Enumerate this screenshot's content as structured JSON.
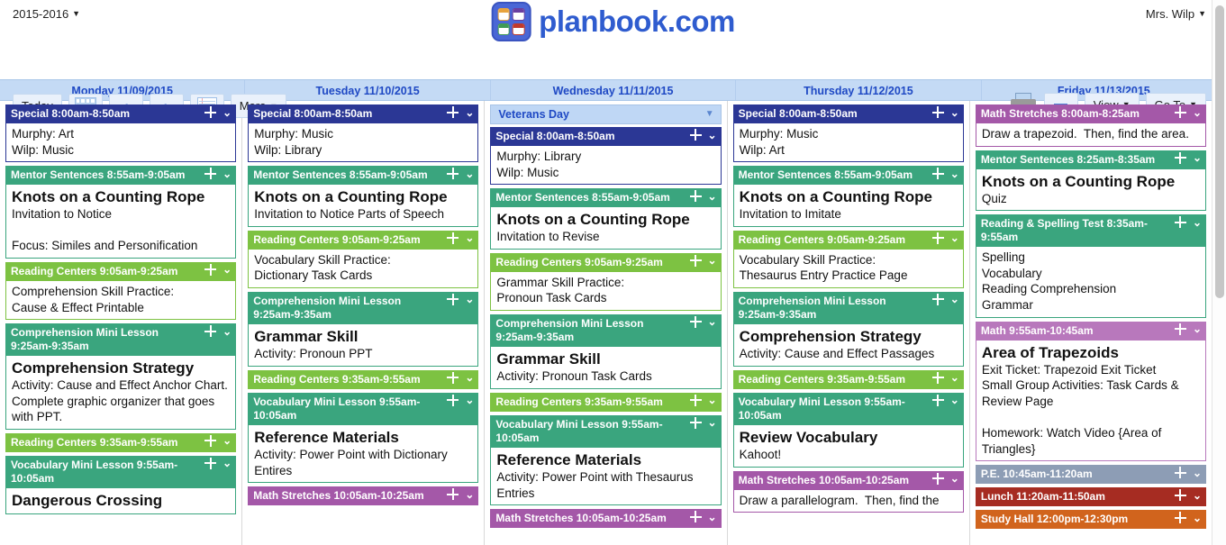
{
  "header": {
    "year_label": "2015-2016",
    "brand": "planbook.com",
    "user": "Mrs. Wilp"
  },
  "toolbar": {
    "today_label": "Today",
    "calendar_icon": "calendar-icon",
    "prev_icon": "‹",
    "next_icon": "›",
    "lines_icon": "lined-paper-icon",
    "more_label": "More",
    "print_icon": "printer-icon",
    "collapse_label": "—",
    "view_label": "View",
    "goto_label": "Go To"
  },
  "colors": {
    "special": "#2b3795",
    "mentor": "#3aa57e",
    "reading_centers": "#7dc242",
    "comprehension": "#3aa57e",
    "vocabulary": "#3aa57e",
    "math": "#a458a8",
    "test": "#3aa57e",
    "pe": "#8d9db5",
    "lunch": "#a62c22",
    "study_hall": "#d1641d",
    "banner": "#bfd7f5",
    "dayheader_text": "#1f49c4"
  },
  "days": [
    {
      "label": "Monday 11/09/2015",
      "banner": null,
      "cards": [
        {
          "title": "Special 8:00am-8:50am",
          "color": "#2b3795",
          "body_lines": [
            {
              "text": "Murphy: Art",
              "style": "sub"
            },
            {
              "text": "Wilp: Music",
              "style": "sub"
            }
          ]
        },
        {
          "title": "Mentor Sentences 8:55am-9:05am",
          "color": "#3aa57e",
          "body_lines": [
            {
              "text": "Knots on a Counting Rope",
              "style": "big"
            },
            {
              "text": "Invitation to Notice",
              "style": "sub"
            },
            {
              "text": "",
              "style": "sub"
            },
            {
              "text": "Focus: Similes and Personification",
              "style": "sub"
            }
          ]
        },
        {
          "title": "Reading Centers 9:05am-9:25am",
          "color": "#7dc242",
          "body_lines": [
            {
              "text": "Comprehension Skill Practice:",
              "style": "sub"
            },
            {
              "text": "Cause & Effect Printable",
              "style": "sub"
            }
          ]
        },
        {
          "title": "Comprehension Mini Lesson 9:25am-9:35am",
          "color": "#3aa57e",
          "body_lines": [
            {
              "text": "Comprehension Strategy",
              "style": "big"
            },
            {
              "text": "Activity: Cause and Effect Anchor Chart. Complete graphic organizer that goes with PPT.",
              "style": "sub"
            }
          ]
        },
        {
          "title": "Reading Centers 9:35am-9:55am",
          "color": "#7dc242",
          "body_lines": []
        },
        {
          "title": "Vocabulary Mini Lesson 9:55am-10:05am",
          "color": "#3aa57e",
          "body_lines": [
            {
              "text": "Dangerous Crossing",
              "style": "big"
            }
          ]
        }
      ]
    },
    {
      "label": "Tuesday 11/10/2015",
      "banner": null,
      "cards": [
        {
          "title": "Special 8:00am-8:50am",
          "color": "#2b3795",
          "body_lines": [
            {
              "text": "Murphy: Music",
              "style": "sub"
            },
            {
              "text": "Wilp: Library",
              "style": "sub"
            }
          ]
        },
        {
          "title": "Mentor Sentences 8:55am-9:05am",
          "color": "#3aa57e",
          "body_lines": [
            {
              "text": "Knots on a Counting Rope",
              "style": "big"
            },
            {
              "text": "Invitation to Notice Parts of Speech",
              "style": "sub"
            }
          ]
        },
        {
          "title": "Reading Centers 9:05am-9:25am",
          "color": "#7dc242",
          "body_lines": [
            {
              "text": "Vocabulary Skill Practice:",
              "style": "sub"
            },
            {
              "text": "Dictionary Task Cards",
              "style": "sub"
            }
          ]
        },
        {
          "title": "Comprehension Mini Lesson 9:25am-9:35am",
          "color": "#3aa57e",
          "body_lines": [
            {
              "text": "Grammar Skill",
              "style": "big"
            },
            {
              "text": "Activity: Pronoun PPT",
              "style": "sub"
            }
          ]
        },
        {
          "title": "Reading Centers 9:35am-9:55am",
          "color": "#7dc242",
          "body_lines": []
        },
        {
          "title": "Vocabulary Mini Lesson 9:55am-10:05am",
          "color": "#3aa57e",
          "body_lines": [
            {
              "text": "Reference Materials",
              "style": "big"
            },
            {
              "text": "Activity: Power Point with Dictionary Entires",
              "style": "sub"
            }
          ]
        },
        {
          "title": "Math Stretches 10:05am-10:25am",
          "color": "#a458a8",
          "body_lines": []
        }
      ]
    },
    {
      "label": "Wednesday 11/11/2015",
      "banner": "Veterans Day",
      "cards": [
        {
          "title": "Special 8:00am-8:50am",
          "color": "#2b3795",
          "body_lines": [
            {
              "text": "Murphy: Library",
              "style": "sub"
            },
            {
              "text": "Wilp: Music",
              "style": "sub"
            }
          ]
        },
        {
          "title": "Mentor Sentences 8:55am-9:05am",
          "color": "#3aa57e",
          "body_lines": [
            {
              "text": "Knots on a Counting Rope",
              "style": "big"
            },
            {
              "text": "Invitation to Revise",
              "style": "sub"
            }
          ]
        },
        {
          "title": "Reading Centers 9:05am-9:25am",
          "color": "#7dc242",
          "body_lines": [
            {
              "text": "Grammar Skill Practice:",
              "style": "sub"
            },
            {
              "text": "Pronoun Task Cards",
              "style": "sub"
            }
          ]
        },
        {
          "title": "Comprehension Mini Lesson 9:25am-9:35am",
          "color": "#3aa57e",
          "body_lines": [
            {
              "text": "Grammar Skill",
              "style": "big"
            },
            {
              "text": "Activity: Pronoun Task Cards",
              "style": "sub"
            }
          ]
        },
        {
          "title": "Reading Centers 9:35am-9:55am",
          "color": "#7dc242",
          "body_lines": []
        },
        {
          "title": "Vocabulary Mini Lesson 9:55am-10:05am",
          "color": "#3aa57e",
          "body_lines": [
            {
              "text": "Reference Materials",
              "style": "big"
            },
            {
              "text": "Activity: Power Point with Thesaurus Entries",
              "style": "sub"
            }
          ]
        },
        {
          "title": "Math Stretches 10:05am-10:25am",
          "color": "#a458a8",
          "body_lines": []
        }
      ]
    },
    {
      "label": "Thursday 11/12/2015",
      "banner": null,
      "cards": [
        {
          "title": "Special 8:00am-8:50am",
          "color": "#2b3795",
          "body_lines": [
            {
              "text": "Murphy: Music",
              "style": "sub"
            },
            {
              "text": "Wilp: Art",
              "style": "sub"
            }
          ]
        },
        {
          "title": "Mentor Sentences 8:55am-9:05am",
          "color": "#3aa57e",
          "body_lines": [
            {
              "text": "Knots on a Counting Rope",
              "style": "big"
            },
            {
              "text": "Invitation to Imitate",
              "style": "sub"
            }
          ]
        },
        {
          "title": "Reading Centers 9:05am-9:25am",
          "color": "#7dc242",
          "body_lines": [
            {
              "text": "Vocabulary Skill Practice:",
              "style": "sub"
            },
            {
              "text": "Thesaurus Entry Practice Page",
              "style": "sub"
            }
          ]
        },
        {
          "title": "Comprehension Mini Lesson 9:25am-9:35am",
          "color": "#3aa57e",
          "body_lines": [
            {
              "text": "Comprehension Strategy",
              "style": "big"
            },
            {
              "text": "Activity: Cause and Effect Passages",
              "style": "sub"
            }
          ]
        },
        {
          "title": "Reading Centers 9:35am-9:55am",
          "color": "#7dc242",
          "body_lines": []
        },
        {
          "title": "Vocabulary Mini Lesson 9:55am-10:05am",
          "color": "#3aa57e",
          "body_lines": [
            {
              "text": "Review Vocabulary",
              "style": "big"
            },
            {
              "text": "Kahoot!",
              "style": "sub"
            }
          ]
        },
        {
          "title": "Math Stretches 10:05am-10:25am",
          "color": "#a458a8",
          "body_lines": [
            {
              "text": "Draw a parallelogram.  Then, find the",
              "style": "sub"
            }
          ]
        }
      ]
    },
    {
      "label": "Friday 11/13/2015",
      "banner": null,
      "cards": [
        {
          "title": "Math Stretches 8:00am-8:25am",
          "color": "#a458a8",
          "body_lines": [
            {
              "text": "Draw a trapezoid.  Then, find the area.",
              "style": "sub"
            }
          ]
        },
        {
          "title": "Mentor Sentences 8:25am-8:35am",
          "color": "#3aa57e",
          "body_lines": [
            {
              "text": "Knots on a Counting Rope",
              "style": "big"
            },
            {
              "text": "Quiz",
              "style": "sub"
            }
          ]
        },
        {
          "title": "Reading & Spelling Test 8:35am-9:55am",
          "color": "#3aa57e",
          "body_lines": [
            {
              "text": "Spelling",
              "style": "sub"
            },
            {
              "text": "Vocabulary",
              "style": "sub"
            },
            {
              "text": "Reading Comprehension",
              "style": "sub"
            },
            {
              "text": "Grammar",
              "style": "sub"
            }
          ]
        },
        {
          "title": "Math 9:55am-10:45am",
          "color": "#b878bc",
          "body_lines": [
            {
              "text": "Area of Trapezoids",
              "style": "big"
            },
            {
              "text": "Exit Ticket: Trapezoid Exit Ticket",
              "style": "sub"
            },
            {
              "text": "Small Group Activities: Task Cards & Review Page",
              "style": "sub"
            },
            {
              "text": "",
              "style": "sub"
            },
            {
              "text": "Homework: Watch Video {Area of Triangles}",
              "style": "sub"
            }
          ]
        },
        {
          "title": "P.E. 10:45am-11:20am",
          "color": "#8d9db5",
          "body_lines": []
        },
        {
          "title": "Lunch 11:20am-11:50am",
          "color": "#a62c22",
          "body_lines": []
        },
        {
          "title": "Study Hall 12:00pm-12:30pm",
          "color": "#d1641d",
          "body_lines": []
        }
      ]
    }
  ]
}
